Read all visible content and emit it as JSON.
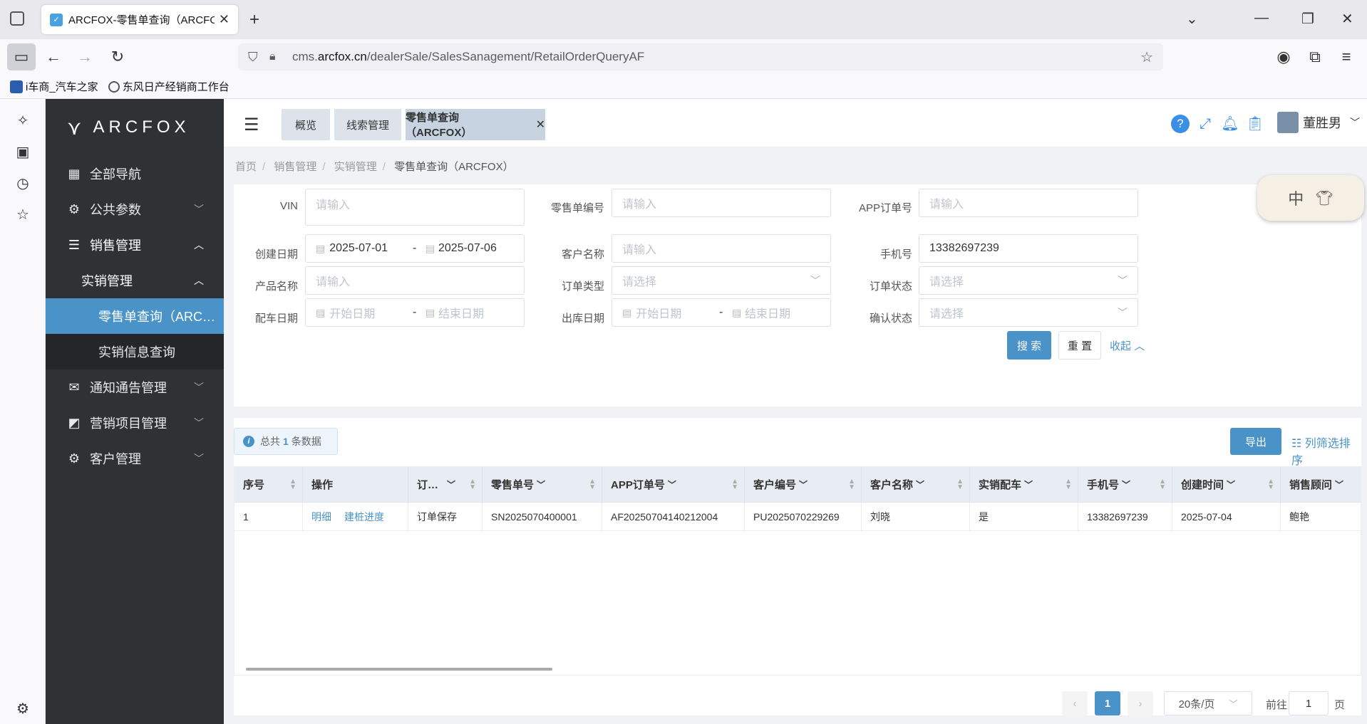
{
  "browser": {
    "tab_title": "ARCFOX-零售单查询（ARCFOX",
    "url_prefix": "cms.",
    "url_domain": "arcfox.cn",
    "url_path": "/dealerSale/SalesSanagement/RetailOrderQueryAF",
    "bookmarks": [
      "i车商_汽车之家",
      "东风日产经销商工作台"
    ]
  },
  "sidebar": {
    "logo": "ARCFOX",
    "items": [
      {
        "label": "全部导航"
      },
      {
        "label": "公共参数"
      },
      {
        "label": "销售管理"
      },
      {
        "label": "实销管理"
      },
      {
        "label": "零售单查询（ARC…"
      },
      {
        "label": "实销信息查询"
      },
      {
        "label": "通知通告管理"
      },
      {
        "label": "营销项目管理"
      },
      {
        "label": "客户管理"
      }
    ]
  },
  "topbar": {
    "tabs": [
      "概览",
      "线索管理",
      "零售单查询（ARCFOX）"
    ],
    "user": "董胜男"
  },
  "breadcrumb": [
    "首页",
    "销售管理",
    "实销管理",
    "零售单查询（ARCFOX）"
  ],
  "filter": {
    "vin_label": "VIN",
    "retail_no_label": "零售单编号",
    "app_order_label": "APP订单号",
    "create_date_label": "创建日期",
    "customer_name_label": "客户名称",
    "phone_label": "手机号",
    "product_label": "产品名称",
    "order_type_label": "订单类型",
    "order_status_label": "订单状态",
    "match_date_label": "配车日期",
    "out_date_label": "出库日期",
    "confirm_status_label": "确认状态",
    "placeholder_input": "请输入",
    "placeholder_select": "请选择",
    "start_date": "开始日期",
    "end_date": "结束日期",
    "create_start": "2025-07-01",
    "create_end": "2025-07-06",
    "phone_value": "13382697239",
    "dash": "-",
    "search": "搜 索",
    "reset": "重 置",
    "collapse": "收起"
  },
  "table": {
    "total_prefix": "总共",
    "total_count": "1",
    "total_suffix": "条数据",
    "export": "导出",
    "col_sort": "列筛选排序",
    "headers": [
      "序号",
      "操作",
      "订…",
      "零售单号",
      "APP订单号",
      "客户编号",
      "客户名称",
      "实销配车",
      "手机号",
      "创建时间",
      "销售顾问"
    ],
    "row": {
      "index": "1",
      "action_detail": "明细",
      "action_progress": "建桩进度",
      "order_status": "订单保存",
      "retail_no": "SN2025070400001",
      "app_no": "AF20250704140212004",
      "customer_no": "PU2025070229269",
      "customer_name": "刘晓",
      "matched": "是",
      "phone": "13382697239",
      "created": "2025-07-04",
      "advisor": "鲍艳"
    }
  },
  "pager": {
    "current": "1",
    "size": "20条/页",
    "goto_label": "前往",
    "goto_value": "1",
    "page_suffix": "页"
  },
  "ime": {
    "label": "中"
  }
}
